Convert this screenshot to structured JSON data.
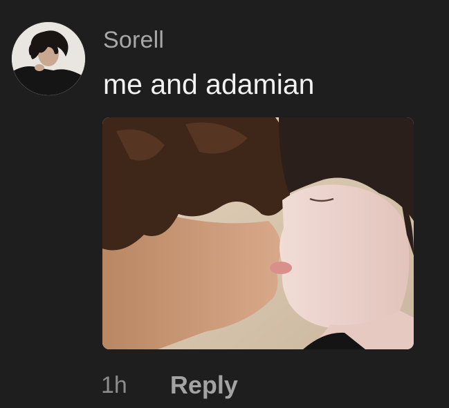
{
  "comment": {
    "username": "Sorell",
    "text": "me and adamian",
    "timestamp": "1h",
    "reply_label": "Reply"
  }
}
